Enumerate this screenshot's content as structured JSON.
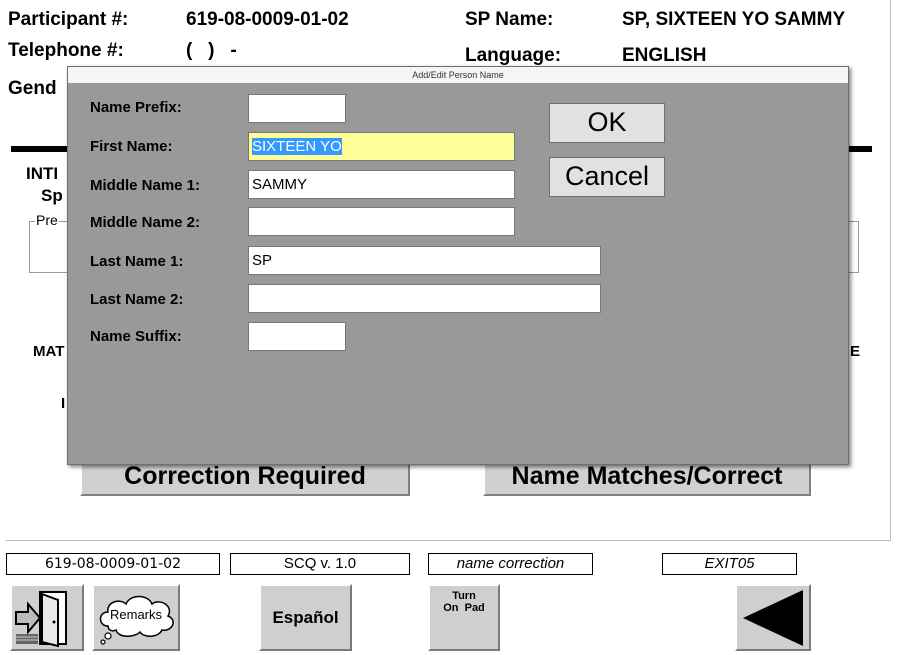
{
  "header": {
    "participant_label": "Participant #:",
    "participant_value": "619-08-0009-01-02",
    "sp_name_label": "SP Name:",
    "sp_name_value": "SP, SIXTEEN YO  SAMMY",
    "telephone_label": "Telephone #:",
    "telephone_value": "(   )   -",
    "language_label": "Language:",
    "language_value": "ENGLISH",
    "gender_label": "Gend"
  },
  "background": {
    "inti_text": "INTI",
    "sp_text": "Sp",
    "pre_text": "Pre",
    "mat_text": "MAT",
    "e_text": "E",
    "i_text": "I",
    "correction_button": "Correction Required",
    "matches_button": "Name Matches/Correct"
  },
  "dialog": {
    "title": "Add/Edit Person Name",
    "fields": {
      "prefix_label": "Name Prefix:",
      "prefix_value": "",
      "first_label": "First Name:",
      "first_value": "SIXTEEN YO",
      "middle1_label": "Middle Name 1:",
      "middle1_value": "SAMMY",
      "middle2_label": "Middle Name 2:",
      "middle2_value": "",
      "last1_label": "Last Name 1:",
      "last1_value": "SP",
      "last2_label": "Last Name 2:",
      "last2_value": "",
      "suffix_label": "Name Suffix:",
      "suffix_value": ""
    },
    "ok_label": "OK",
    "cancel_label": "Cancel"
  },
  "statusbar": {
    "participant": "619-08-0009-01-02",
    "version": "SCQ v. 1.0",
    "section": "name correction",
    "exit_code": "EXIT05"
  },
  "toolbar": {
    "remarks_label": "Remarks",
    "espanol_label": "Español",
    "turn_label": "Turn",
    "on_pad_label": "On  Pad"
  },
  "colors": {
    "dialog_bg": "#999999",
    "selected_field_bg": "#ffff99",
    "selection_highlight": "#3399ff"
  },
  "icons": [
    "exit-door-icon",
    "remarks-cloud-icon",
    "back-arrow-icon"
  ]
}
